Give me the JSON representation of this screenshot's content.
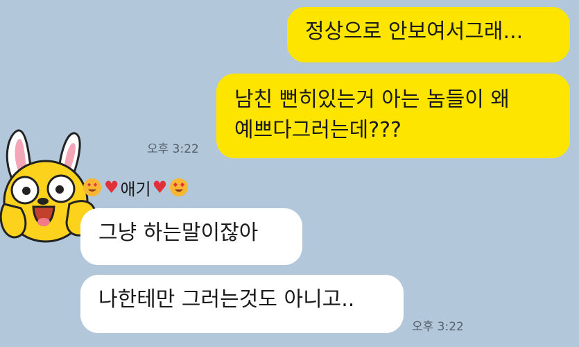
{
  "colors": {
    "background": "#b2c7da",
    "outgoing_bubble": "#fee500",
    "incoming_bubble": "#ffffff",
    "heart": "#e0313b"
  },
  "messages_out": [
    {
      "text": "정상으로 안보여서그래..."
    },
    {
      "line1": "남친 뻔히있는거 아는 놈들이 왜",
      "line2": "예쁘다그러는데???"
    }
  ],
  "timestamp_out": "오후 3:22",
  "sender": {
    "name": "애기",
    "decoration_icons": [
      "heart-eyes-emoji",
      "red-heart",
      "red-heart",
      "heart-eyes-emoji"
    ]
  },
  "messages_in": [
    {
      "text": "그냥 하는말이잖아"
    },
    {
      "text": "나한테만 그러는것도 아니고.."
    }
  ],
  "timestamp_in": "오후 3:22"
}
